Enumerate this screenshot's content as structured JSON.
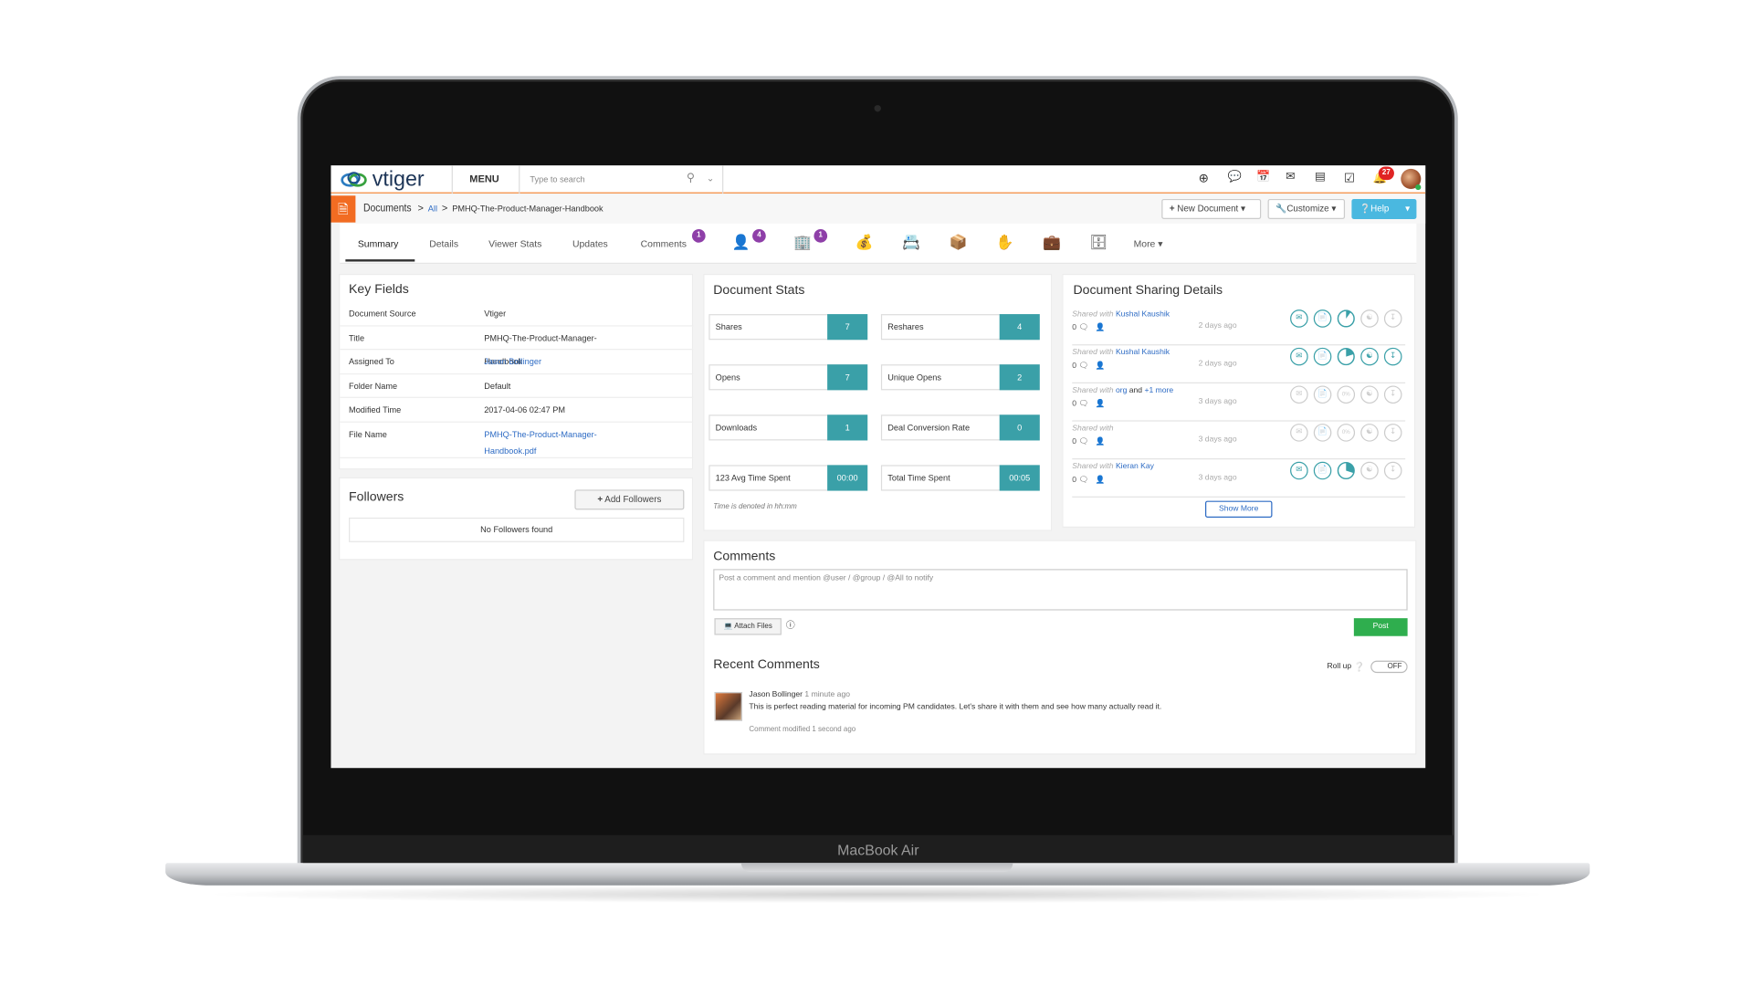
{
  "device": {
    "label": "MacBook Air"
  },
  "header": {
    "logo_text": "vtiger",
    "menu_label": "MENU",
    "search_placeholder": "Type to search",
    "notification_count": "27",
    "icons": [
      "plus-circle-icon",
      "chat-icon",
      "calendar-icon",
      "mail-icon",
      "reports-icon",
      "tasks-icon",
      "bell-icon"
    ]
  },
  "breadcrumb": {
    "module": "Documents",
    "filter": "All",
    "record": "PMHQ-The-Product-Manager-Handbook"
  },
  "actions": {
    "new_document": "New Document",
    "customize": "Customize",
    "help": "Help"
  },
  "tabs": [
    {
      "label": "Summary",
      "active": true
    },
    {
      "label": "Details"
    },
    {
      "label": "Viewer Stats"
    },
    {
      "label": "Updates"
    },
    {
      "label": "Comments",
      "badge": "1"
    }
  ],
  "icon_tabs": [
    {
      "icon": "contact-icon",
      "badge": "4"
    },
    {
      "icon": "organization-icon",
      "badge": "1"
    },
    {
      "icon": "money-bag-icon"
    },
    {
      "icon": "contact-card-icon"
    },
    {
      "icon": "product-box-icon"
    },
    {
      "icon": "service-hand-icon"
    },
    {
      "icon": "briefcase-icon"
    },
    {
      "icon": "cabinet-icon"
    }
  ],
  "more_label": "More",
  "key_fields": {
    "title": "Key Fields",
    "rows": [
      {
        "label": "Document Source",
        "value": "Vtiger"
      },
      {
        "label": "Title",
        "value": "PMHQ-The-Product-Manager-Handbook"
      },
      {
        "label": "Assigned To",
        "value": "Jason Bollinger",
        "link": true
      },
      {
        "label": "Folder Name",
        "value": "Default"
      },
      {
        "label": "Modified Time",
        "value": "2017-04-06 02:47 PM"
      },
      {
        "label": "File Name",
        "value": "PMHQ-The-Product-Manager-Handbook.pdf",
        "link": true
      }
    ]
  },
  "followers": {
    "title": "Followers",
    "add_label": "Add Followers",
    "empty": "No Followers found"
  },
  "stats": {
    "title": "Document Stats",
    "items": [
      {
        "label": "Shares",
        "value": "7"
      },
      {
        "label": "Reshares",
        "value": "4"
      },
      {
        "label": "Opens",
        "value": "7"
      },
      {
        "label": "Unique Opens",
        "value": "2"
      },
      {
        "label": "Downloads",
        "value": "1"
      },
      {
        "label": "Deal Conversion Rate",
        "value": "0"
      },
      {
        "label": "123 Avg Time Spent",
        "value": "00:00"
      },
      {
        "label": "Total Time Spent",
        "value": "00:05"
      }
    ],
    "note": "Time is denoted in hh:mm"
  },
  "sharing": {
    "title": "Document Sharing Details",
    "show_more": "Show More",
    "accent": "#3aa0a8",
    "rows": [
      {
        "prefix": "Shared with",
        "name": "Kushal Kaushik",
        "comments": "0",
        "time": "2 days ago",
        "active": [
          true,
          true,
          true,
          false,
          false
        ],
        "view_fraction": 0.1
      },
      {
        "prefix": "Shared with",
        "name": "Kushal Kaushik",
        "comments": "0",
        "time": "2 days ago",
        "active": [
          true,
          true,
          true,
          true,
          true
        ],
        "view_fraction": 0.2
      },
      {
        "prefix": "Shared with",
        "name": "org",
        "conj": "and",
        "more": "+1 more",
        "comments": "0",
        "time": "3 days ago",
        "active": [
          false,
          false,
          false,
          false,
          false
        ],
        "view_label": "0%"
      },
      {
        "prefix": "Shared with",
        "name": "",
        "comments": "0",
        "time": "3 days ago",
        "active": [
          false,
          false,
          false,
          false,
          false
        ],
        "view_label": "0%"
      },
      {
        "prefix": "Shared with",
        "name": "Kieran Kay",
        "comments": "0",
        "time": "3 days ago",
        "active": [
          true,
          true,
          true,
          false,
          false
        ],
        "view_fraction": 0.3
      }
    ]
  },
  "comments": {
    "title": "Comments",
    "placeholder": "Post a comment and mention @user / @group / @All to notify",
    "attach_label": "Attach Files",
    "post_label": "Post",
    "recent_title": "Recent Comments",
    "rollup_label": "Roll up",
    "rollup_state": "OFF",
    "items": [
      {
        "author": "Jason Bollinger",
        "time": "1 minute ago",
        "text": "This is perfect reading material for incoming PM candidates. Let's share it with them and see how many actually read it.",
        "modified": "Comment modified 1 second ago"
      }
    ]
  }
}
